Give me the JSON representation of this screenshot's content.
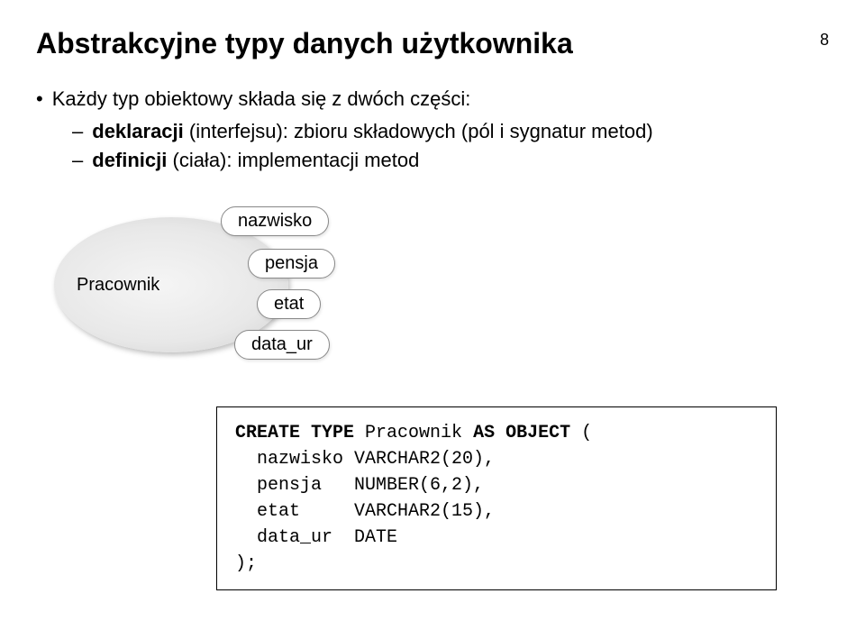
{
  "page": {
    "title": "Abstrakcyjne typy danych użytkownika",
    "pagenum": "8"
  },
  "bullets": {
    "main": "Każdy typ obiektowy składa się z dwóch części:",
    "sub1_bold": "deklaracji",
    "sub1_rest": " (interfejsu): zbioru składowych (pól i sygnatur metod)",
    "sub2_bold": "definicji",
    "sub2_rest": " (ciała): implementacji metod"
  },
  "diagram": {
    "entity": "Pracownik",
    "attr1": "nazwisko",
    "attr2": "pensja",
    "attr3": "etat",
    "attr4": "data_ur"
  },
  "code": {
    "kw_create": "CREATE TYPE",
    "type_name": " Pracownik ",
    "kw_asobj": "AS OBJECT",
    "open": " (",
    "line1": "  nazwisko VARCHAR2(20),",
    "line2": "  pensja   NUMBER(6,2),",
    "line3": "  etat     VARCHAR2(15),",
    "line4": "  data_ur  DATE",
    "close": ");"
  }
}
